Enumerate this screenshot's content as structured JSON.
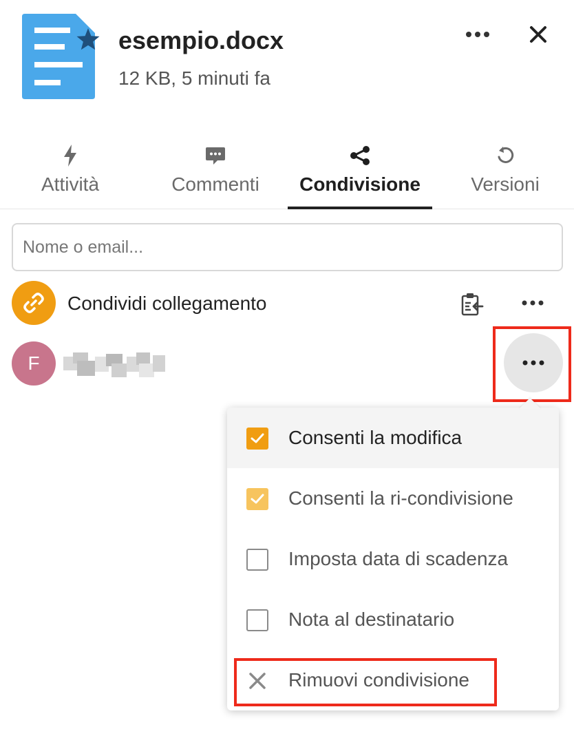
{
  "file": {
    "name": "esempio.docx",
    "meta": "12 KB, 5 minuti fa",
    "icon": "document-icon",
    "favorite_icon": "star-icon"
  },
  "header": {
    "more_icon": "more-horizontal-icon",
    "close_icon": "close-icon"
  },
  "tabs": [
    {
      "label": "Attività",
      "icon": "lightning-icon",
      "active": false
    },
    {
      "label": "Commenti",
      "icon": "comment-icon",
      "active": false
    },
    {
      "label": "Condivisione",
      "icon": "share-icon",
      "active": true
    },
    {
      "label": "Versioni",
      "icon": "history-icon",
      "active": false
    }
  ],
  "search": {
    "placeholder": "Nome o email...",
    "value": ""
  },
  "share_link": {
    "label": "Condividi collegamento",
    "icon": "link-icon",
    "copy_icon": "clipboard-icon",
    "more_icon": "more-horizontal-icon"
  },
  "share_user": {
    "avatar_letter": "F",
    "more_icon": "more-horizontal-icon"
  },
  "menu": {
    "items": [
      {
        "label": "Consenti la modifica",
        "icon": "checkbox-checked",
        "active": true
      },
      {
        "label": "Consenti la ri-condivisione",
        "icon": "checkbox-checked-disabled",
        "active": false
      },
      {
        "label": "Imposta data di scadenza",
        "icon": "checkbox-unchecked",
        "active": false
      },
      {
        "label": "Nota al destinatario",
        "icon": "checkbox-unchecked",
        "active": false
      },
      {
        "label": "Rimuovi condivisione",
        "icon": "close-icon",
        "active": false
      }
    ]
  },
  "colors": {
    "accent": "#f09d12",
    "file_blue": "#4aa8ea",
    "avatar_user": "#c8758c",
    "highlight": "#ee2a1b"
  }
}
